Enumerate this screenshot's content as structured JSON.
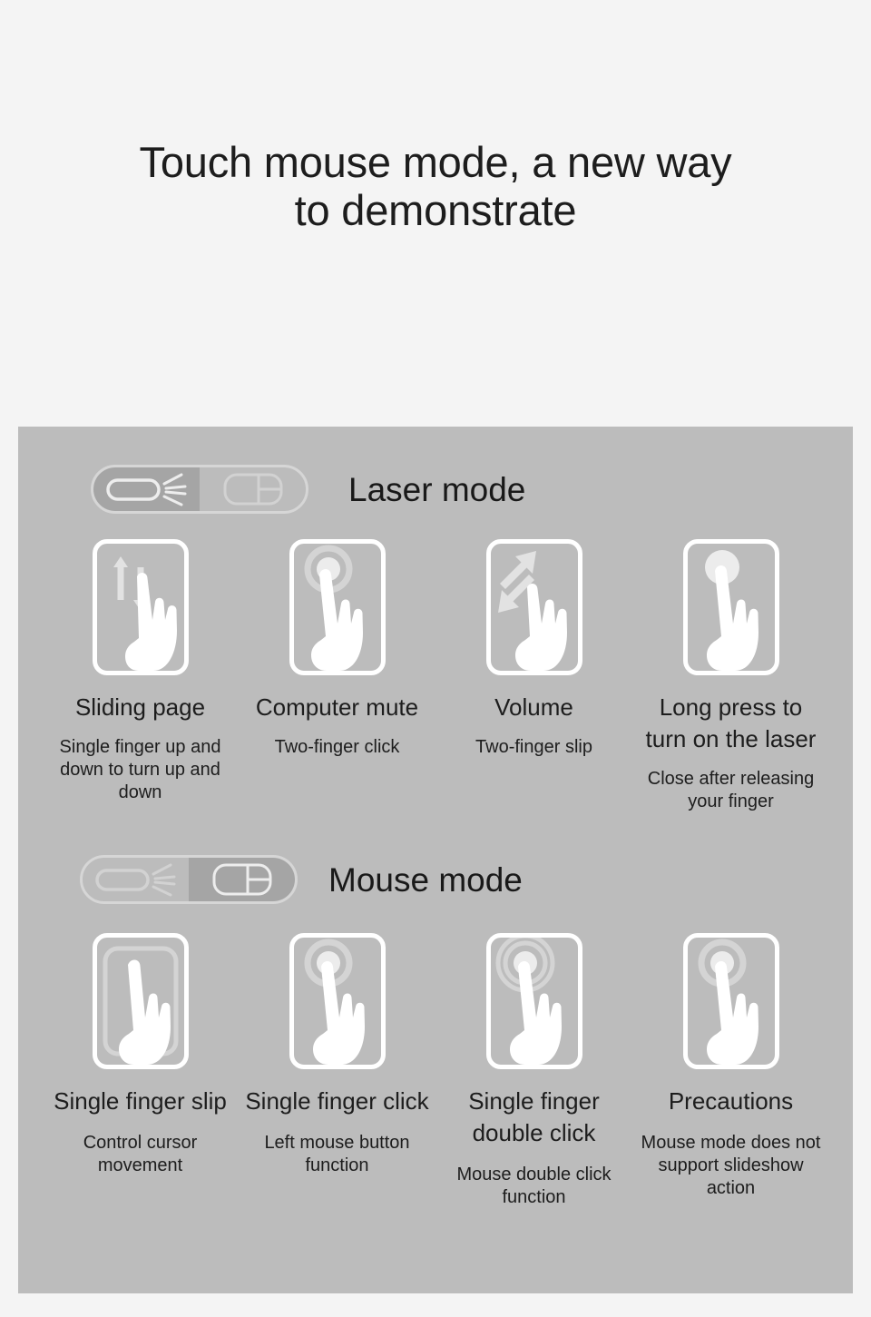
{
  "hero": {
    "title": "Touch mouse mode, a new way to demonstrate"
  },
  "colors": {
    "page_background": "#f4f4f4",
    "panel_background": "#bcbcbc",
    "toggle_active": "#a5a5a5",
    "toggle_track_border": "#d6d6d6",
    "icon_white": "#ffffff",
    "text": "#1d1d1d"
  },
  "sections": [
    {
      "id": "laser-mode",
      "mode_label": "Laser mode",
      "toggle": {
        "left_icon": "laser-icon",
        "right_icon": "mouse-icon",
        "active_side": "left"
      },
      "items": [
        {
          "icon": "swipe-up-down-icon",
          "label": "Sliding page",
          "sub": "Single finger up and down to turn up and down"
        },
        {
          "icon": "two-finger-tap-icon",
          "label": "Computer mute",
          "sub": "Two-finger click"
        },
        {
          "icon": "two-finger-diagonal-slide-icon",
          "label": "Volume",
          "sub": "Two-finger slip"
        },
        {
          "icon": "long-press-icon",
          "label": "Long press to turn on the laser",
          "sub": "Close after releasing your finger"
        }
      ]
    },
    {
      "id": "mouse-mode",
      "mode_label": "Mouse mode",
      "toggle": {
        "left_icon": "laser-icon",
        "right_icon": "mouse-icon",
        "active_side": "right"
      },
      "items": [
        {
          "icon": "single-finger-slide-icon",
          "label": "Single finger slip",
          "sub": "Control cursor movement"
        },
        {
          "icon": "single-finger-click-icon",
          "label": "Single finger click",
          "sub": "Left mouse button function"
        },
        {
          "icon": "single-finger-double-click-icon",
          "label": "Single finger double click",
          "sub": "Mouse double click function"
        },
        {
          "icon": "precautions-icon",
          "label": "Precautions",
          "sub": "Mouse mode does not support slideshow action"
        }
      ]
    }
  ]
}
